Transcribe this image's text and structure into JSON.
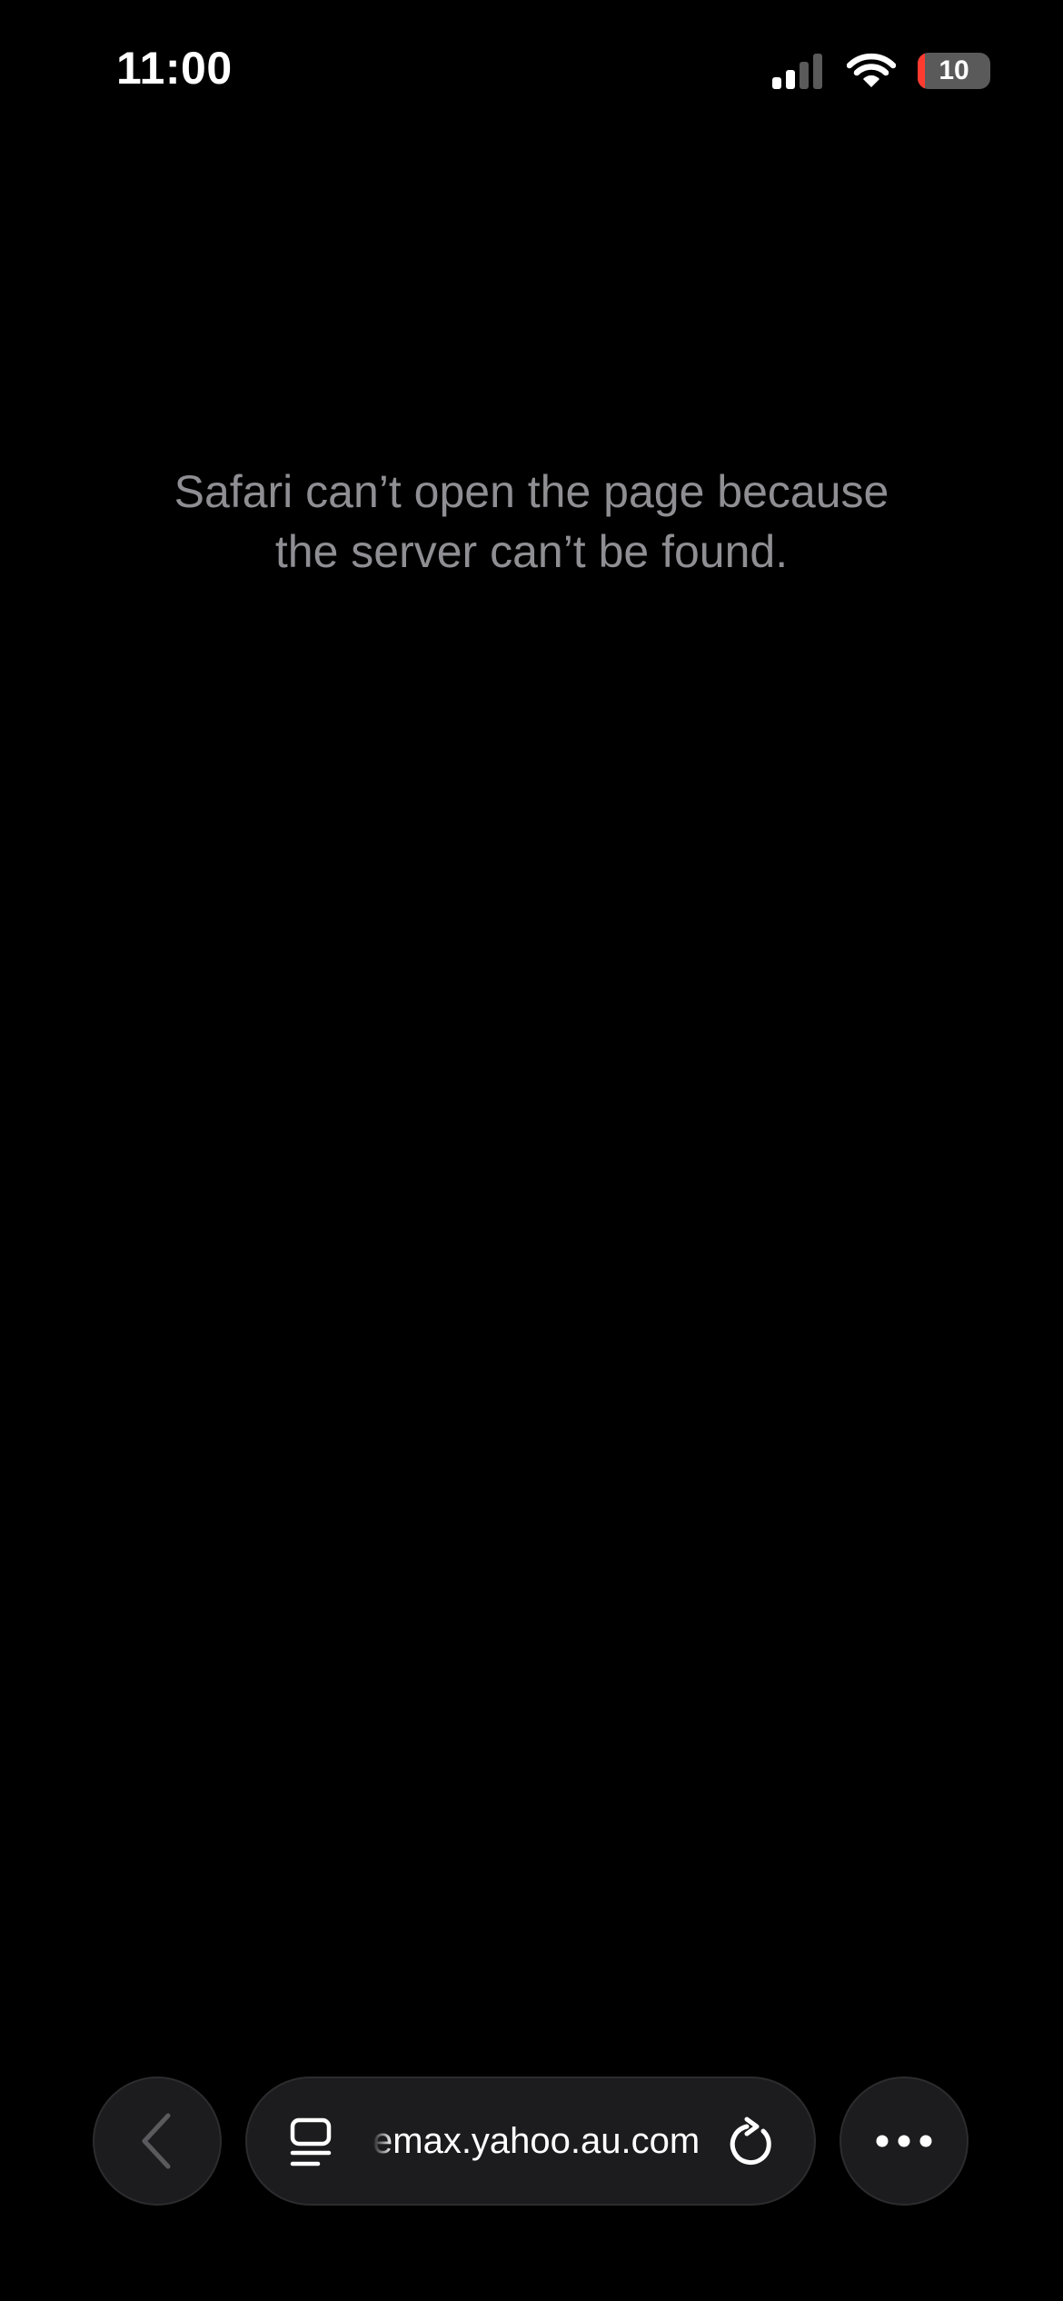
{
  "status_bar": {
    "time": "11:00",
    "battery_percent": "10",
    "battery_level": 0.1,
    "battery_low_color": "#ff3b30",
    "signal_bars_active": 2,
    "signal_bars_total": 4,
    "icons": [
      "cellular-signal-icon",
      "wifi-icon",
      "battery-icon"
    ]
  },
  "content": {
    "error_line1": "Safari can’t open the page because",
    "error_line2": "the server can’t be found."
  },
  "toolbar": {
    "url": "emax.yahoo.au.com",
    "icons": [
      "back-chevron-icon",
      "tabs-icon",
      "reload-icon",
      "more-icon"
    ]
  },
  "colors": {
    "background": "#000000",
    "error_text": "#8e8e93",
    "toolbar_button": "#1c1c1e",
    "disabled_icon": "#5a5a5e"
  }
}
